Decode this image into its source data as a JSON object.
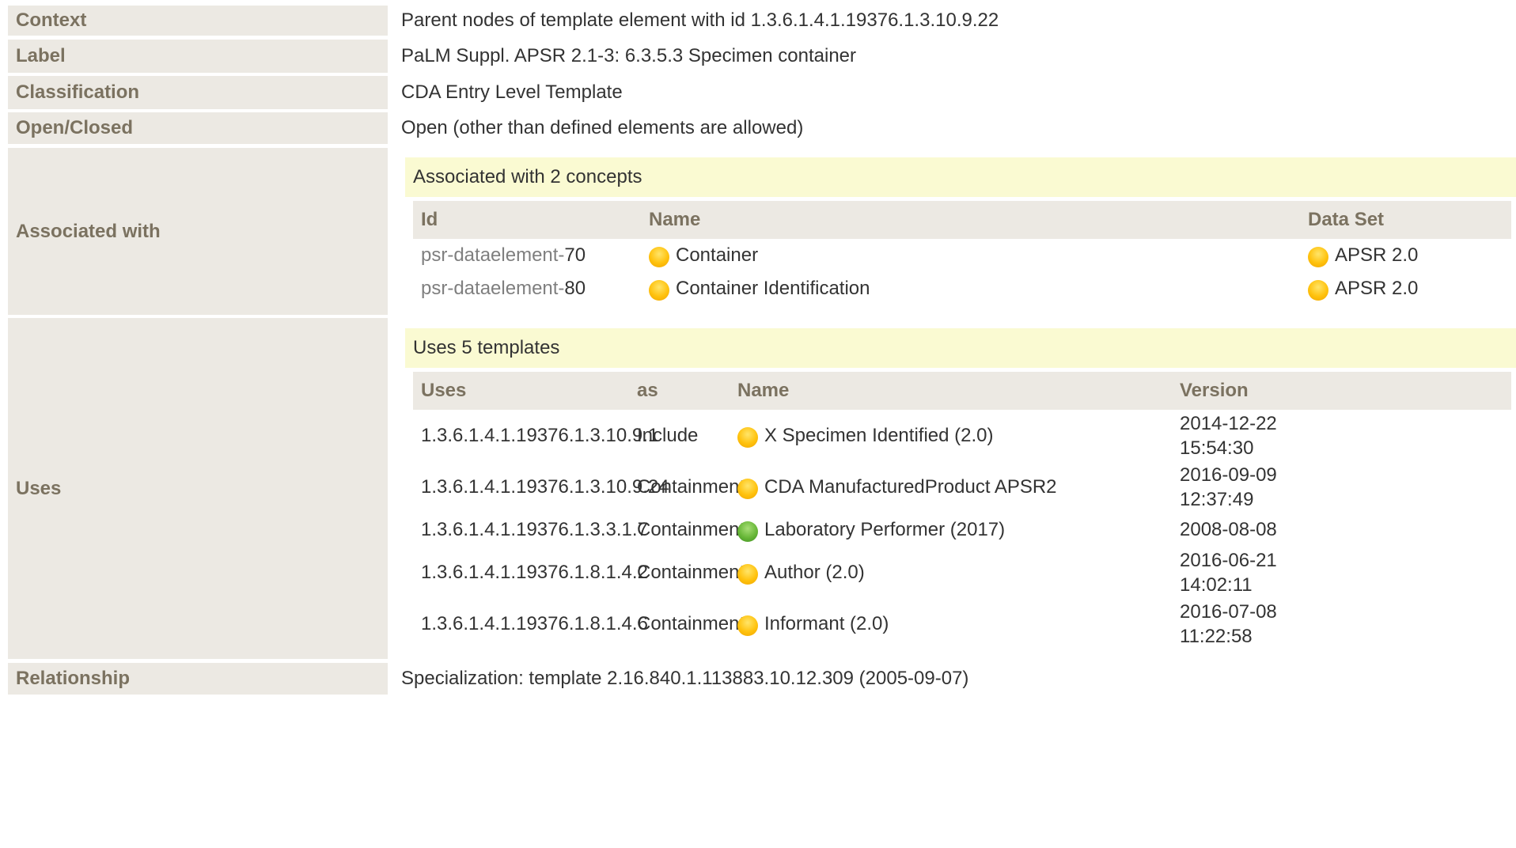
{
  "rows": {
    "context": {
      "label": "Context",
      "value": "Parent nodes of template element with id 1.3.6.1.4.1.19376.1.3.10.9.22"
    },
    "label": {
      "label": "Label",
      "value": "PaLM Suppl. APSR 2.1-3: 6.3.5.3 Specimen container"
    },
    "classification": {
      "label": "Classification",
      "value": "CDA Entry Level Template"
    },
    "open_closed": {
      "label": "Open/Closed",
      "value": "Open (other than defined elements are allowed)"
    },
    "associated_with": {
      "label": "Associated with"
    },
    "uses": {
      "label": "Uses"
    },
    "relationship": {
      "label": "Relationship",
      "value": "Specialization: template 2.16.840.1.113883.10.12.309 (2005-09-07)"
    }
  },
  "concepts": {
    "banner": "Associated with 2 concepts",
    "headers": {
      "id": "Id",
      "name": "Name",
      "dataset": "Data Set"
    },
    "items": [
      {
        "id_prefix": "psr-dataelement-",
        "id_num": "70",
        "name": "Container",
        "dataset": "APSR 2.0",
        "status_icon": "draft-status-icon",
        "dataset_icon": "draft-status-icon"
      },
      {
        "id_prefix": "psr-dataelement-",
        "id_num": "80",
        "name": "Container Identification",
        "dataset": "APSR 2.0",
        "status_icon": "draft-status-icon",
        "dataset_icon": "draft-status-icon"
      }
    ]
  },
  "templates": {
    "banner": "Uses 5 templates",
    "headers": {
      "uses": "Uses",
      "as": "as",
      "name": "Name",
      "version": "Version"
    },
    "items": [
      {
        "oid": "1.3.6.1.4.1.19376.1.3.10.9.1",
        "as": "Include",
        "name": "X Specimen Identified (2.0)",
        "version": "2014-12-22\n15:54:30",
        "status": "draft"
      },
      {
        "oid": "1.3.6.1.4.1.19376.1.3.10.9.24",
        "as": "Containment",
        "name": "CDA ManufacturedProduct APSR2",
        "version": "2016-09-09\n12:37:49",
        "status": "draft"
      },
      {
        "oid": "1.3.6.1.4.1.19376.1.3.3.1.7",
        "as": "Containment",
        "name": "Laboratory Performer (2017)",
        "version": "2008-08-08",
        "status": "final"
      },
      {
        "oid": "1.3.6.1.4.1.19376.1.8.1.4.2",
        "as": "Containment",
        "name": "Author (2.0)",
        "version": "2016-06-21\n14:02:11",
        "status": "draft"
      },
      {
        "oid": "1.3.6.1.4.1.19376.1.8.1.4.6",
        "as": "Containment",
        "name": "Informant (2.0)",
        "version": "2016-07-08\n11:22:58",
        "status": "draft"
      }
    ]
  },
  "colors": {
    "label_bg": "#ece9e3",
    "label_text": "#7b7260",
    "banner_bg": "#fafad2",
    "status_draft": "#ffc20d",
    "status_final": "#68b738"
  }
}
